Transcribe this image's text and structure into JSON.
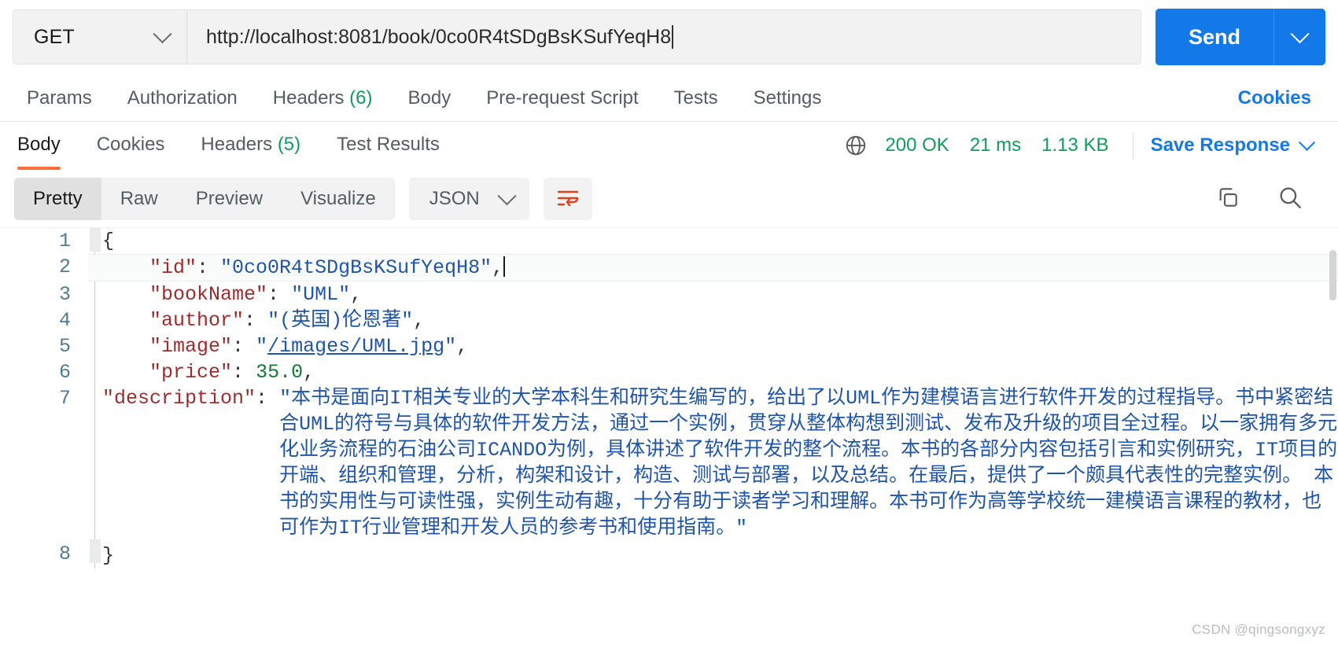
{
  "request": {
    "method": "GET",
    "method_icon": "chevron-down-icon",
    "url": "http://localhost:8081/book/0co0R4tSDgBsKSufYeqH8",
    "send_label": "Send",
    "send_caret_icon": "chevron-down-icon",
    "tabs": [
      {
        "label": "Params",
        "count": ""
      },
      {
        "label": "Authorization",
        "count": ""
      },
      {
        "label": "Headers",
        "count": "(6)"
      },
      {
        "label": "Body",
        "count": ""
      },
      {
        "label": "Pre-request Script",
        "count": ""
      },
      {
        "label": "Tests",
        "count": ""
      },
      {
        "label": "Settings",
        "count": ""
      }
    ],
    "cookies_link": "Cookies"
  },
  "response": {
    "tabs": [
      {
        "label": "Body",
        "count": "",
        "active": true
      },
      {
        "label": "Cookies",
        "count": "",
        "active": false
      },
      {
        "label": "Headers",
        "count": "(5)",
        "active": false
      },
      {
        "label": "Test Results",
        "count": "",
        "active": false
      }
    ],
    "globe_icon": "globe-icon",
    "status": "200 OK",
    "time": "21 ms",
    "size": "1.13 KB",
    "save_label": "Save Response",
    "save_caret_icon": "chevron-down-icon",
    "format_tabs": [
      "Pretty",
      "Raw",
      "Preview",
      "Visualize"
    ],
    "active_format": "Pretty",
    "language": "JSON",
    "language_caret_icon": "chevron-down-icon",
    "wrap_icon": "wrap-text-icon",
    "copy_icon": "copy-icon",
    "search_icon": "search-icon"
  },
  "body": {
    "lines": [
      "1",
      "2",
      "3",
      "4",
      "5",
      "6",
      "7",
      "8"
    ],
    "open_brace": "{",
    "close_brace": "}",
    "entries": [
      {
        "key": "\"id\"",
        "colon": ": ",
        "value": "\"0co0R4tSDgBsKSufYeqH8\"",
        "comma": ",",
        "type": "string",
        "highlight": true
      },
      {
        "key": "\"bookName\"",
        "colon": ": ",
        "value": "\"UML\"",
        "comma": ",",
        "type": "string",
        "highlight": false
      },
      {
        "key": "\"author\"",
        "colon": ": ",
        "value": "\"(英国)伦恩著\"",
        "comma": ",",
        "type": "string",
        "highlight": false
      },
      {
        "key": "\"image\"",
        "colon": ": ",
        "value": "/images/UML.jpg",
        "comma": ",",
        "type": "link",
        "highlight": false
      },
      {
        "key": "\"price\"",
        "colon": ": ",
        "value": "35.0",
        "comma": ",",
        "type": "number",
        "highlight": false
      }
    ],
    "description_key": "\"description\"",
    "description_colon": ": ",
    "description_value": "\"本书是面向IT相关专业的大学本科生和研究生编写的，给出了以UML作为建模语言进行软件开发的过程指导。书中紧密结合UML的符号与具体的软件开发方法，通过一个实例，贯穿从整体构想到测试、发布及升级的项目全过程。以一家拥有多元化业务流程的石油公司ICANDO为例，具体讲述了软件开发的整个流程。本书的各部分内容包括引言和实例研究，IT项目的开端、组织和管理，分析，构架和设计，构造、测试与部署，以及总结。在最后，提供了一个颇具代表性的完整实例。 本书的实用性与可读性强，实例生动有趣，十分有助于读者学习和理解。本书可作为高等学校统一建模语言课程的教材，也可作为IT行业管理和开发人员的参考书和使用指南。\""
  },
  "watermark": "CSDN @qingsongxyz",
  "colors": {
    "accent_blue": "#1479e8",
    "status_green": "#0f9d58",
    "active_orange": "#ff6c37",
    "json_key": "#9e2c2c",
    "json_string": "#1f55a8",
    "json_number": "#127a39"
  }
}
